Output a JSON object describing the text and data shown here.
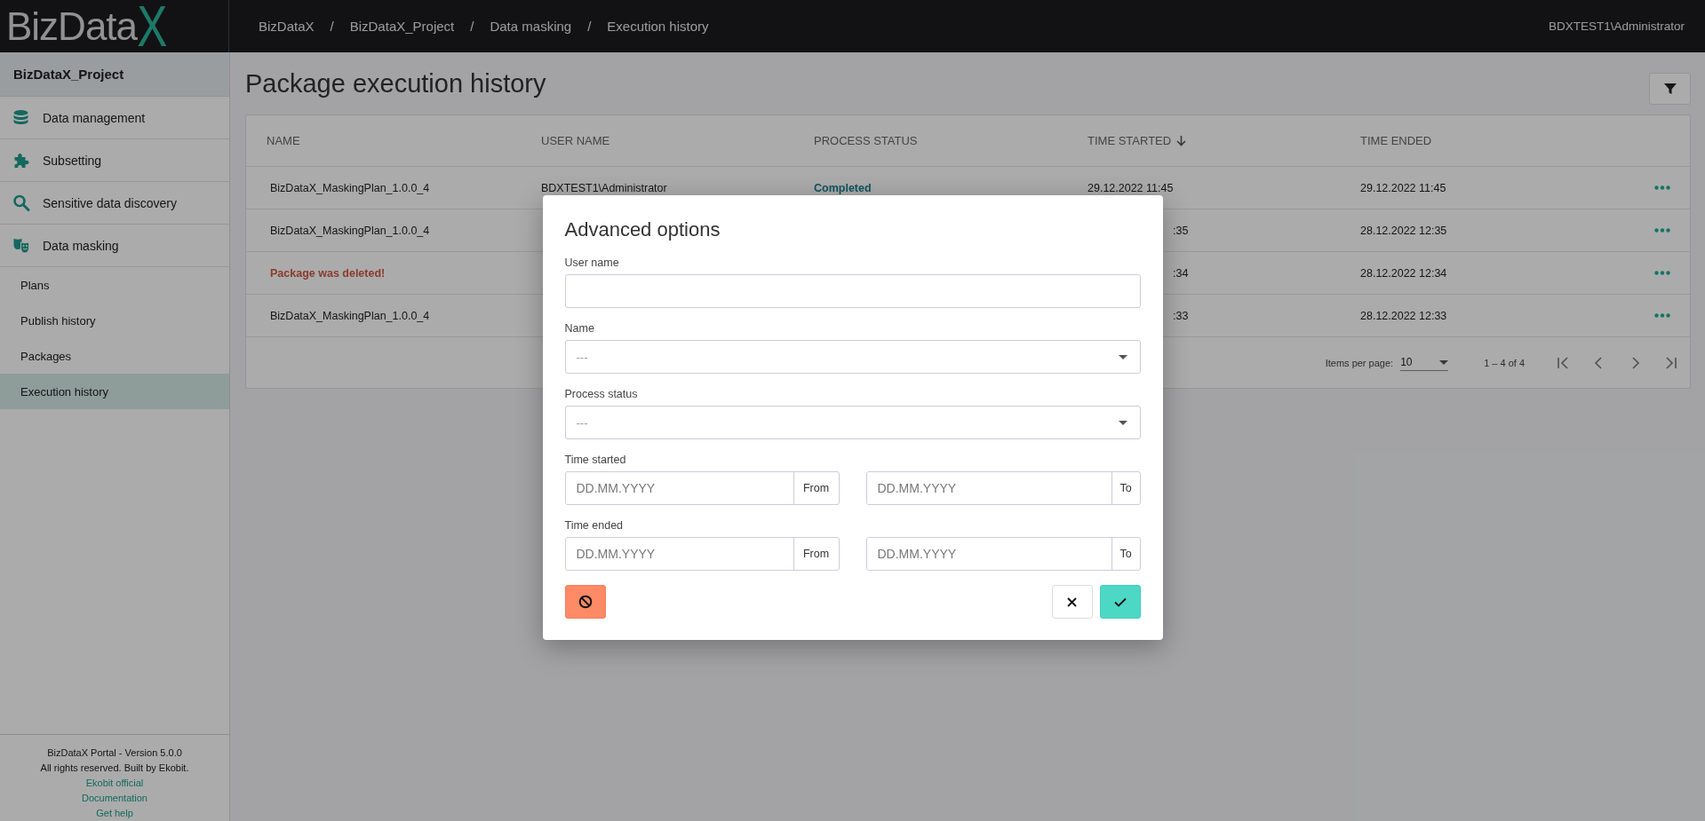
{
  "header": {
    "logo_text": "BizData",
    "logo_mark": "X",
    "breadcrumbs": [
      "BizDataX",
      "BizDataX_Project",
      "Data masking",
      "Execution history"
    ],
    "breadcrumb_separator": "/",
    "user": "BDXTEST1\\Administrator"
  },
  "sidebar": {
    "project": "BizDataX_Project",
    "items": [
      {
        "label": "Data management",
        "kind": "database"
      },
      {
        "label": "Subsetting",
        "kind": "puzzle"
      },
      {
        "label": "Sensitive data discovery",
        "kind": "search"
      },
      {
        "label": "Data masking",
        "kind": "masks",
        "children": [
          {
            "label": "Plans",
            "selected": false
          },
          {
            "label": "Publish history",
            "selected": false
          },
          {
            "label": "Packages",
            "selected": false
          },
          {
            "label": "Execution history",
            "selected": true
          }
        ]
      }
    ],
    "footer": {
      "lines": [
        "BizDataX Portal - Version 5.0.0",
        "All rights reserved. Built by Ekobit."
      ],
      "links": [
        "Ekobit official",
        "Documentation",
        "Get help"
      ]
    }
  },
  "page": {
    "title": "Package execution history"
  },
  "table": {
    "columns": [
      {
        "label": "NAME",
        "sorted": false
      },
      {
        "label": "USER NAME",
        "sorted": false
      },
      {
        "label": "PROCESS STATUS",
        "sorted": false
      },
      {
        "label": "TIME STARTED",
        "sorted": true
      },
      {
        "label": "TIME ENDED",
        "sorted": false
      }
    ],
    "rows": [
      {
        "kind": "package",
        "name": "BizDataX_MaskingPlan_1.0.0_4",
        "user_name": "BDXTEST1\\Administrator",
        "process_status": "Completed",
        "time_started": "29.12.2022 11:45",
        "time_ended": "29.12.2022 11:45"
      },
      {
        "kind": "package",
        "name": "BizDataX_MaskingPlan_1.0.0_4",
        "time_started": ":35",
        "time_ended": "28.12.2022 12:35"
      },
      {
        "kind": "deleted",
        "name": "Package was deleted!",
        "time_started": ":34",
        "time_ended": "28.12.2022 12:34"
      },
      {
        "kind": "package",
        "name": "BizDataX_MaskingPlan_1.0.0_4",
        "time_started": ":33",
        "time_ended": "28.12.2022 12:33"
      }
    ],
    "paginator": {
      "items_per_page_label": "Items per page:",
      "page_size": "10",
      "range": "1 – 4 of 4"
    }
  },
  "dialog": {
    "title": "Advanced options",
    "fields": [
      {
        "kind": "text",
        "label": "User name"
      },
      {
        "kind": "select",
        "label": "Name",
        "value": "---"
      },
      {
        "kind": "select",
        "label": "Process status",
        "value": "---"
      },
      {
        "kind": "range",
        "label": "Time started",
        "from": {
          "placeholder": "DD.MM.YYYY",
          "addon": "From"
        },
        "to": {
          "placeholder": "DD.MM.YYYY",
          "addon": "To"
        }
      },
      {
        "kind": "range",
        "label": "Time ended",
        "from": {
          "placeholder": "DD.MM.YYYY",
          "addon": "From"
        },
        "to": {
          "placeholder": "DD.MM.YYYY",
          "addon": "To"
        }
      }
    ],
    "buttons": [
      {
        "kind": "reset"
      },
      {
        "kind": "cancel"
      },
      {
        "kind": "apply"
      }
    ]
  }
}
